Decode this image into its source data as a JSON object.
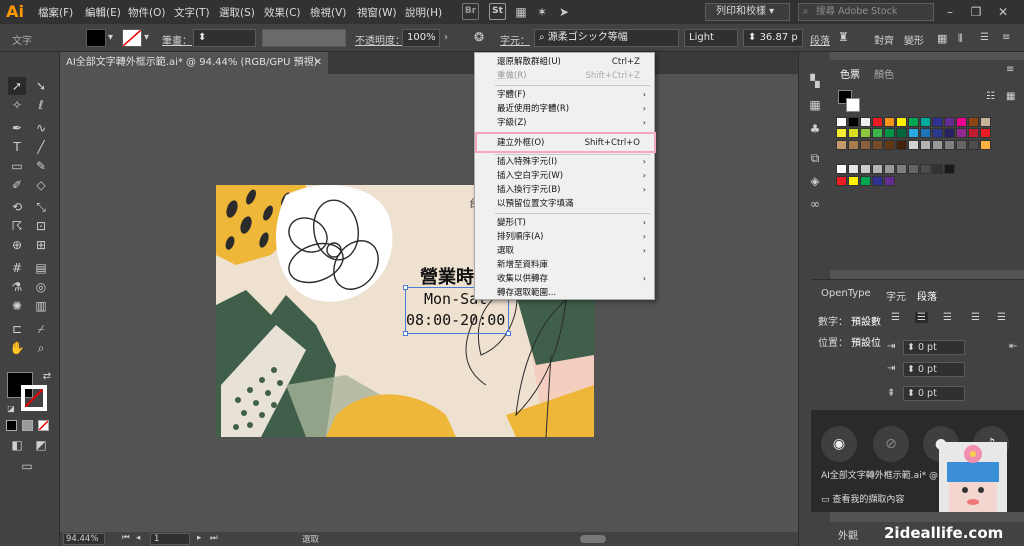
{
  "app": {
    "logo": "Ai"
  },
  "menu": {
    "items": [
      "檔案(F)",
      "編輯(E)",
      "物件(O)",
      "文字(T)",
      "選取(S)",
      "效果(C)",
      "檢視(V)",
      "視窗(W)",
      "說明(H)"
    ],
    "bridge": "Br",
    "stock": "St",
    "workspace": "列印和校樣",
    "search_placeholder": "搜尋 Adobe Stock"
  },
  "control": {
    "type_label": "文字",
    "stroke_label": "筆畫：",
    "opacity_label": "不透明度：",
    "opacity_value": "100%",
    "char_label": "字元：",
    "font_name": "源柔ゴシック等幅",
    "font_style": "Light",
    "font_size": "36.87 p",
    "paragraph_label": "段落",
    "align_label": "對齊",
    "transform_label": "變形"
  },
  "document": {
    "tab_title": "AI全部文字轉外框示範.ai* @ 94.44% (RGB/GPU 預視)"
  },
  "artboard": {
    "line1": "營業時",
    "line2": "Mon-Sat",
    "line3": "08:00-20:00",
    "corner": "台"
  },
  "context_menu": {
    "items": [
      {
        "label": "還原解散群組(U)",
        "shortcut": "Ctrl+Z",
        "disabled": false
      },
      {
        "label": "重做(R)",
        "shortcut": "Shift+Ctrl+Z",
        "disabled": true
      },
      {
        "label": "字體(F)",
        "submenu": true
      },
      {
        "label": "最近使用的字體(R)",
        "submenu": true
      },
      {
        "label": "字級(Z)",
        "submenu": true
      },
      {
        "label": "建立外框(O)",
        "shortcut": "Shift+Ctrl+O",
        "highlighted": true
      },
      {
        "label": "插入特殊字元(I)",
        "submenu": true
      },
      {
        "label": "插入空白字元(W)",
        "submenu": true
      },
      {
        "label": "插入換行字元(B)",
        "submenu": true
      },
      {
        "label": "以預留位置文字填滿"
      },
      {
        "label": "變形(T)",
        "submenu": true
      },
      {
        "label": "排列順序(A)",
        "submenu": true
      },
      {
        "label": "選取",
        "submenu": true
      },
      {
        "label": "新增至資料庫"
      },
      {
        "label": "收集以供轉存",
        "submenu": true
      },
      {
        "label": "轉存選取範圍..."
      }
    ]
  },
  "status": {
    "zoom": "94.44%",
    "artboard_num": "1",
    "mode": "選取"
  },
  "panels": {
    "swatch_tab1": "色票",
    "swatch_tab2": "顏色",
    "opentype_tab": "OpenType",
    "char_tab": "字元",
    "para_tab": "段落",
    "number_label": "數字：",
    "number_value": "預設數",
    "position_label": "位置：",
    "position_value": "預設位",
    "indent1": "0 pt",
    "indent2": "0 pt",
    "indent3": "0 pt",
    "appearance_tab": "外觀"
  },
  "recorder": {
    "view_captures": "查看我的擷取內容",
    "caption": "AI全部文字轉外框示範.ai* @"
  },
  "watermark": {
    "text": "2ideallife.com"
  }
}
